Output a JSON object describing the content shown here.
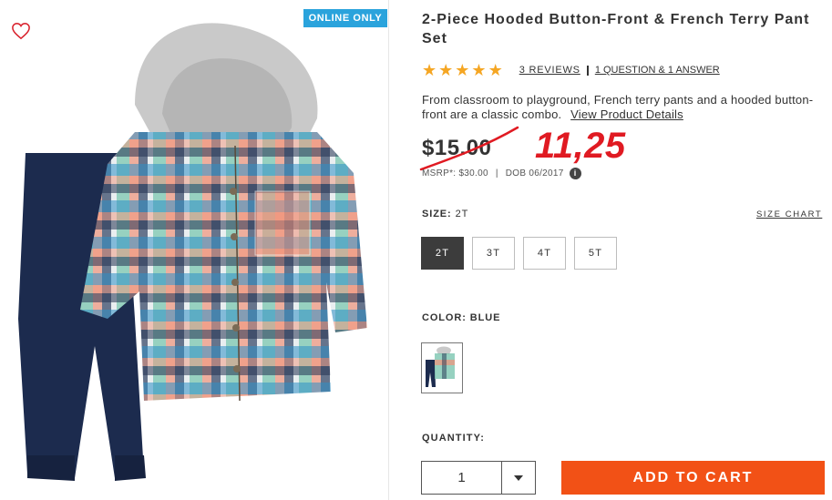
{
  "product": {
    "badge": "ONLINE ONLY",
    "title": "2-Piece Hooded Button-Front & French Terry Pant Set",
    "rating": 5,
    "reviews_label": "3 REVIEWS",
    "qa_label": "1 QUESTION & 1 ANSWER",
    "description": "From classroom to playground, French terry pants and a hooded button-front are a classic combo.",
    "details_link": "View Product Details",
    "price": "$15.00",
    "handwritten_price": "11,25",
    "msrp": "MSRP*: $30.00",
    "dob": "DOB 06/2017",
    "info_icon": "i"
  },
  "size": {
    "label": "SIZE:",
    "selected": "2T",
    "chart_link": "SIZE CHART",
    "options": [
      "2T",
      "3T",
      "4T",
      "5T"
    ]
  },
  "color": {
    "label": "COLOR:",
    "selected": "BLUE"
  },
  "quantity": {
    "label": "QUANTITY:",
    "value": "1"
  },
  "cart": {
    "button_label": "ADD TO CART"
  },
  "colors": {
    "accent_orange": "#f25116",
    "badge_blue": "#2aa3dc",
    "star": "#f5a623",
    "handwritten_red": "#e01a22",
    "wishlist_red": "#d9232e"
  },
  "icons": [
    "heart-icon",
    "star-icon",
    "info-icon",
    "chevron-down-icon"
  ]
}
